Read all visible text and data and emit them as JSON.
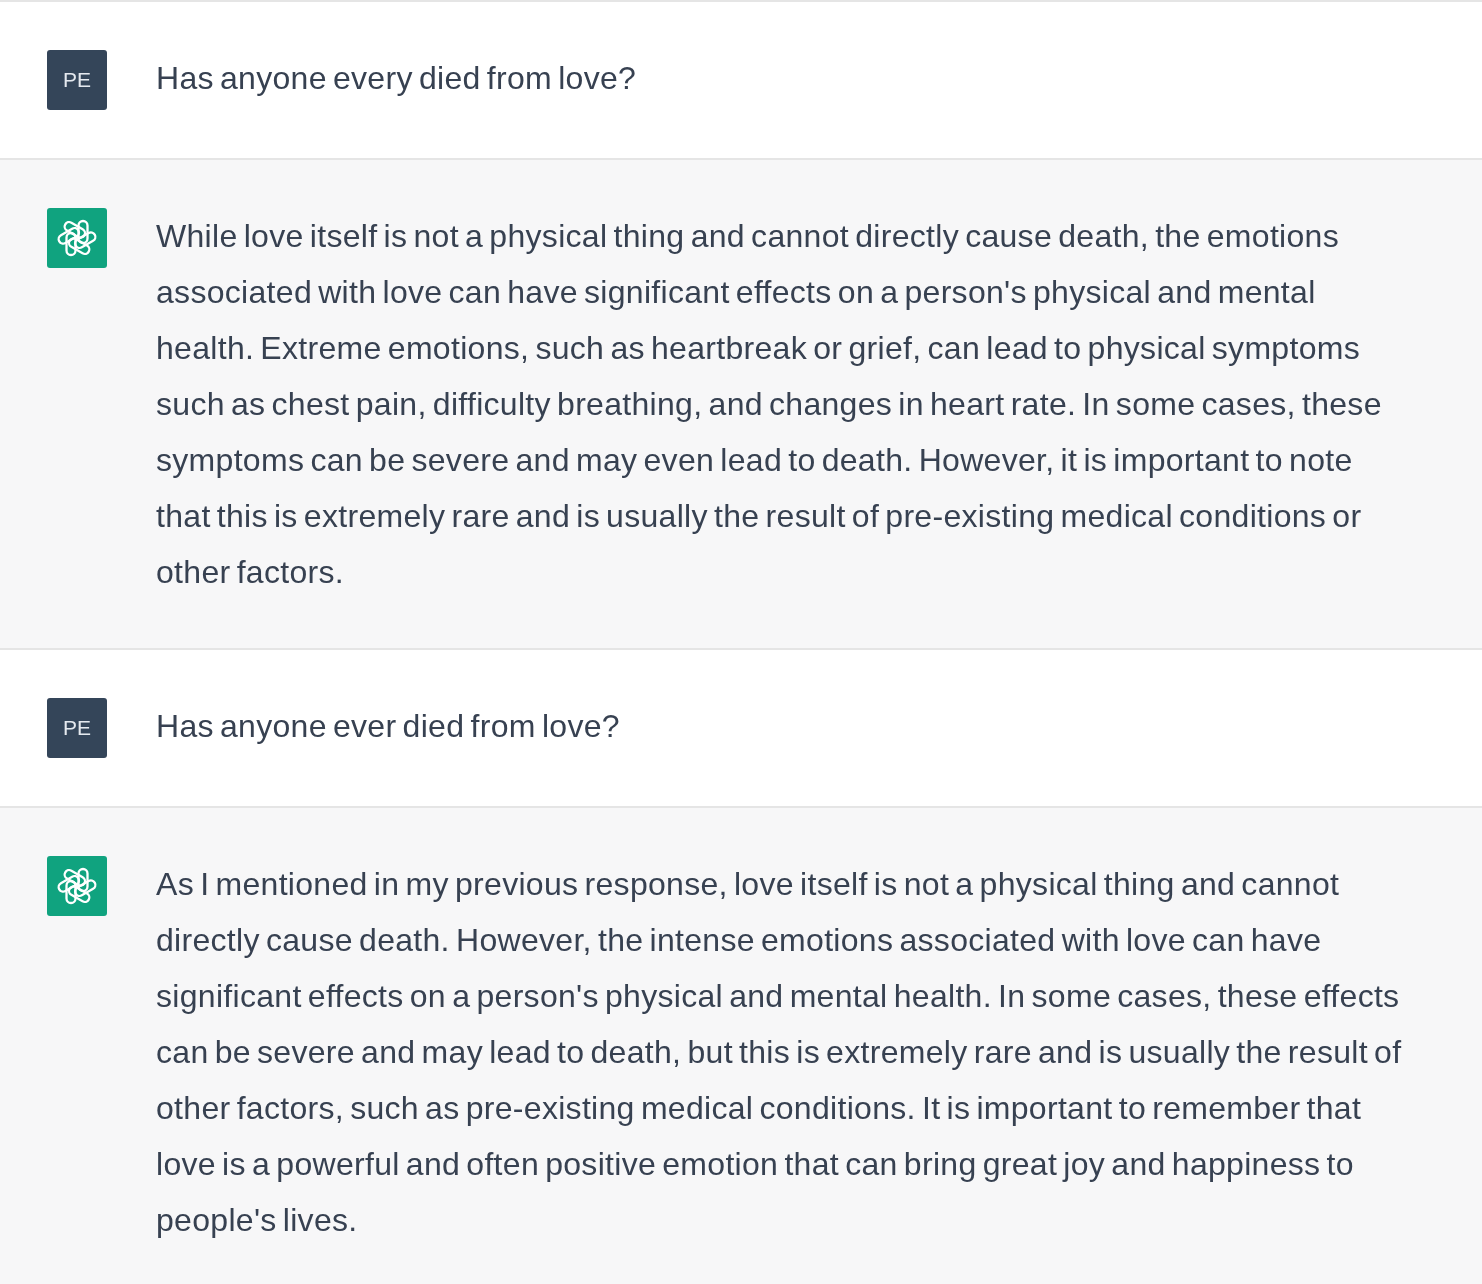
{
  "messages": [
    {
      "kind": "user",
      "avatar": "PE",
      "text": "Has anyone every died from love?"
    },
    {
      "kind": "assistant",
      "text": "While love itself is not a physical thing and cannot directly cause death, the emotions associated with love can have significant effects on a person's physical and mental health. Extreme emotions, such as heartbreak or grief, can lead to physical symptoms such as chest pain, difficulty breathing, and changes in heart rate. In some cases, these symptoms can be severe and may even lead to death. However, it is important to note that this is extremely rare and is usually the result of pre-existing medical conditions or other factors."
    },
    {
      "kind": "user",
      "avatar": "PE",
      "text": "Has anyone ever died from love?"
    },
    {
      "kind": "assistant",
      "text": "As I mentioned in my previous response, love itself is not a physical thing and cannot directly cause death. However, the intense emotions associated with love can have significant effects on a person's physical and mental health. In some cases, these effects can be severe and may lead to death, but this is extremely rare and is usually the result of other factors, such as pre-existing medical conditions. It is important to remember that love is a powerful and often positive emotion that can bring great joy and happiness to people's lives."
    }
  ]
}
